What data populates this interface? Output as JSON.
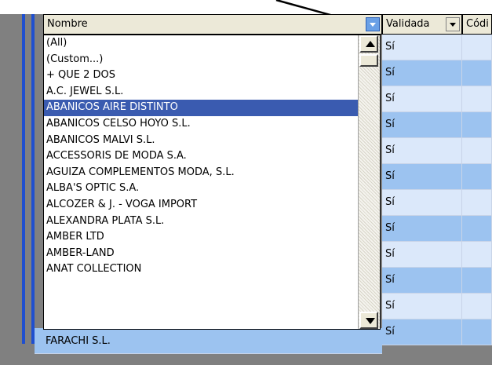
{
  "grid": {
    "columns": {
      "nombre": "Nombre",
      "validada": "Validada",
      "codigo": "Códi"
    },
    "validada_values": [
      "Sí",
      "Sí",
      "Sí",
      "Sí",
      "Sí",
      "Sí",
      "Sí",
      "Sí",
      "Sí",
      "Sí",
      "Sí",
      "Sí"
    ],
    "bottom_row": {
      "nombre": "FARACHI S.L.",
      "validada": "Sí"
    }
  },
  "filter_dropdown": {
    "selected": "ABANICOS AIRE DISTINTO",
    "items": [
      "(All)",
      "(Custom...)",
      "+ QUE 2 DOS",
      "A.C. JEWEL S.L.",
      "ABANICOS AIRE DISTINTO",
      "ABANICOS CELSO HOYO S.L.",
      "ABANICOS MALVI S.L.",
      "ACCESSORIS DE MODA S.A.",
      "AGUIZA COMPLEMENTOS MODA, S.L.",
      "ALBA'S OPTIC S.A.",
      "ALCOZER & J. - VOGA IMPORT",
      "ALEXANDRA PLATA S.L.",
      "AMBER LTD",
      "AMBER-LAND",
      "ANAT COLLECTION"
    ]
  },
  "colors": {
    "selection": "#3a5bb0",
    "row_light": "#dbe8fa",
    "row_dark": "#9cc3f0",
    "arrow": "#000000"
  }
}
